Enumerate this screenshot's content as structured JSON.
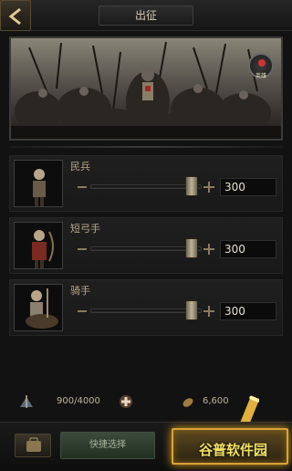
{
  "header": {
    "title": "出征"
  },
  "troops": [
    {
      "name": "民兵",
      "value": "300"
    },
    {
      "name": "短弓手",
      "value": "300"
    },
    {
      "name": "骑手",
      "value": "300"
    }
  ],
  "stats": {
    "capacity": "900/4000",
    "food": "6,600"
  },
  "actions": {
    "quick_select_label": "快捷选择"
  },
  "hero_badge": {
    "label": "英雄"
  },
  "watermark": "谷普软件园",
  "colors": {
    "accent_gold": "#d8a23a",
    "panel": "#1f1f1f",
    "quick_green": "#3b4a3b"
  }
}
